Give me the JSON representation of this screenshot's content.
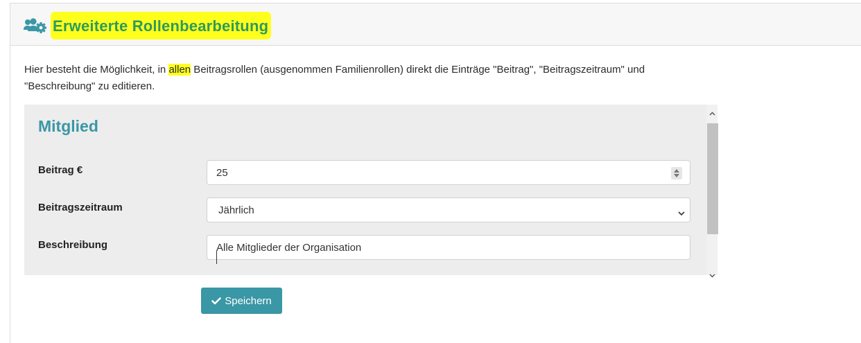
{
  "header": {
    "icon": "users-cog-icon",
    "title": "Erweiterte Rollenbearbeitung"
  },
  "intro": {
    "text_before": "Hier besteht die Möglichkeit, in ",
    "highlight": "allen",
    "text_after": " Beitragsrollen (ausgenommen Familienrollen) direkt die Einträge \"Beitrag\", \"Beitragszeitraum\" und \"Beschreibung\" zu editieren."
  },
  "role": {
    "title": "Mitglied",
    "fields": {
      "beitrag": {
        "label": "Beitrag €",
        "value": "25"
      },
      "zeitraum": {
        "label": "Beitragszeitraum",
        "value": "Jährlich"
      },
      "beschreibung": {
        "label": "Beschreibung",
        "value": "Alle Mitglieder der Organisation"
      }
    }
  },
  "save_button": {
    "label": "Speichern",
    "icon": "check-icon"
  },
  "colors": {
    "accent": "#3a97a5",
    "title_green": "#2f9a5a",
    "highlight_yellow": "#ffff1e",
    "panel_bg": "#ededed"
  }
}
